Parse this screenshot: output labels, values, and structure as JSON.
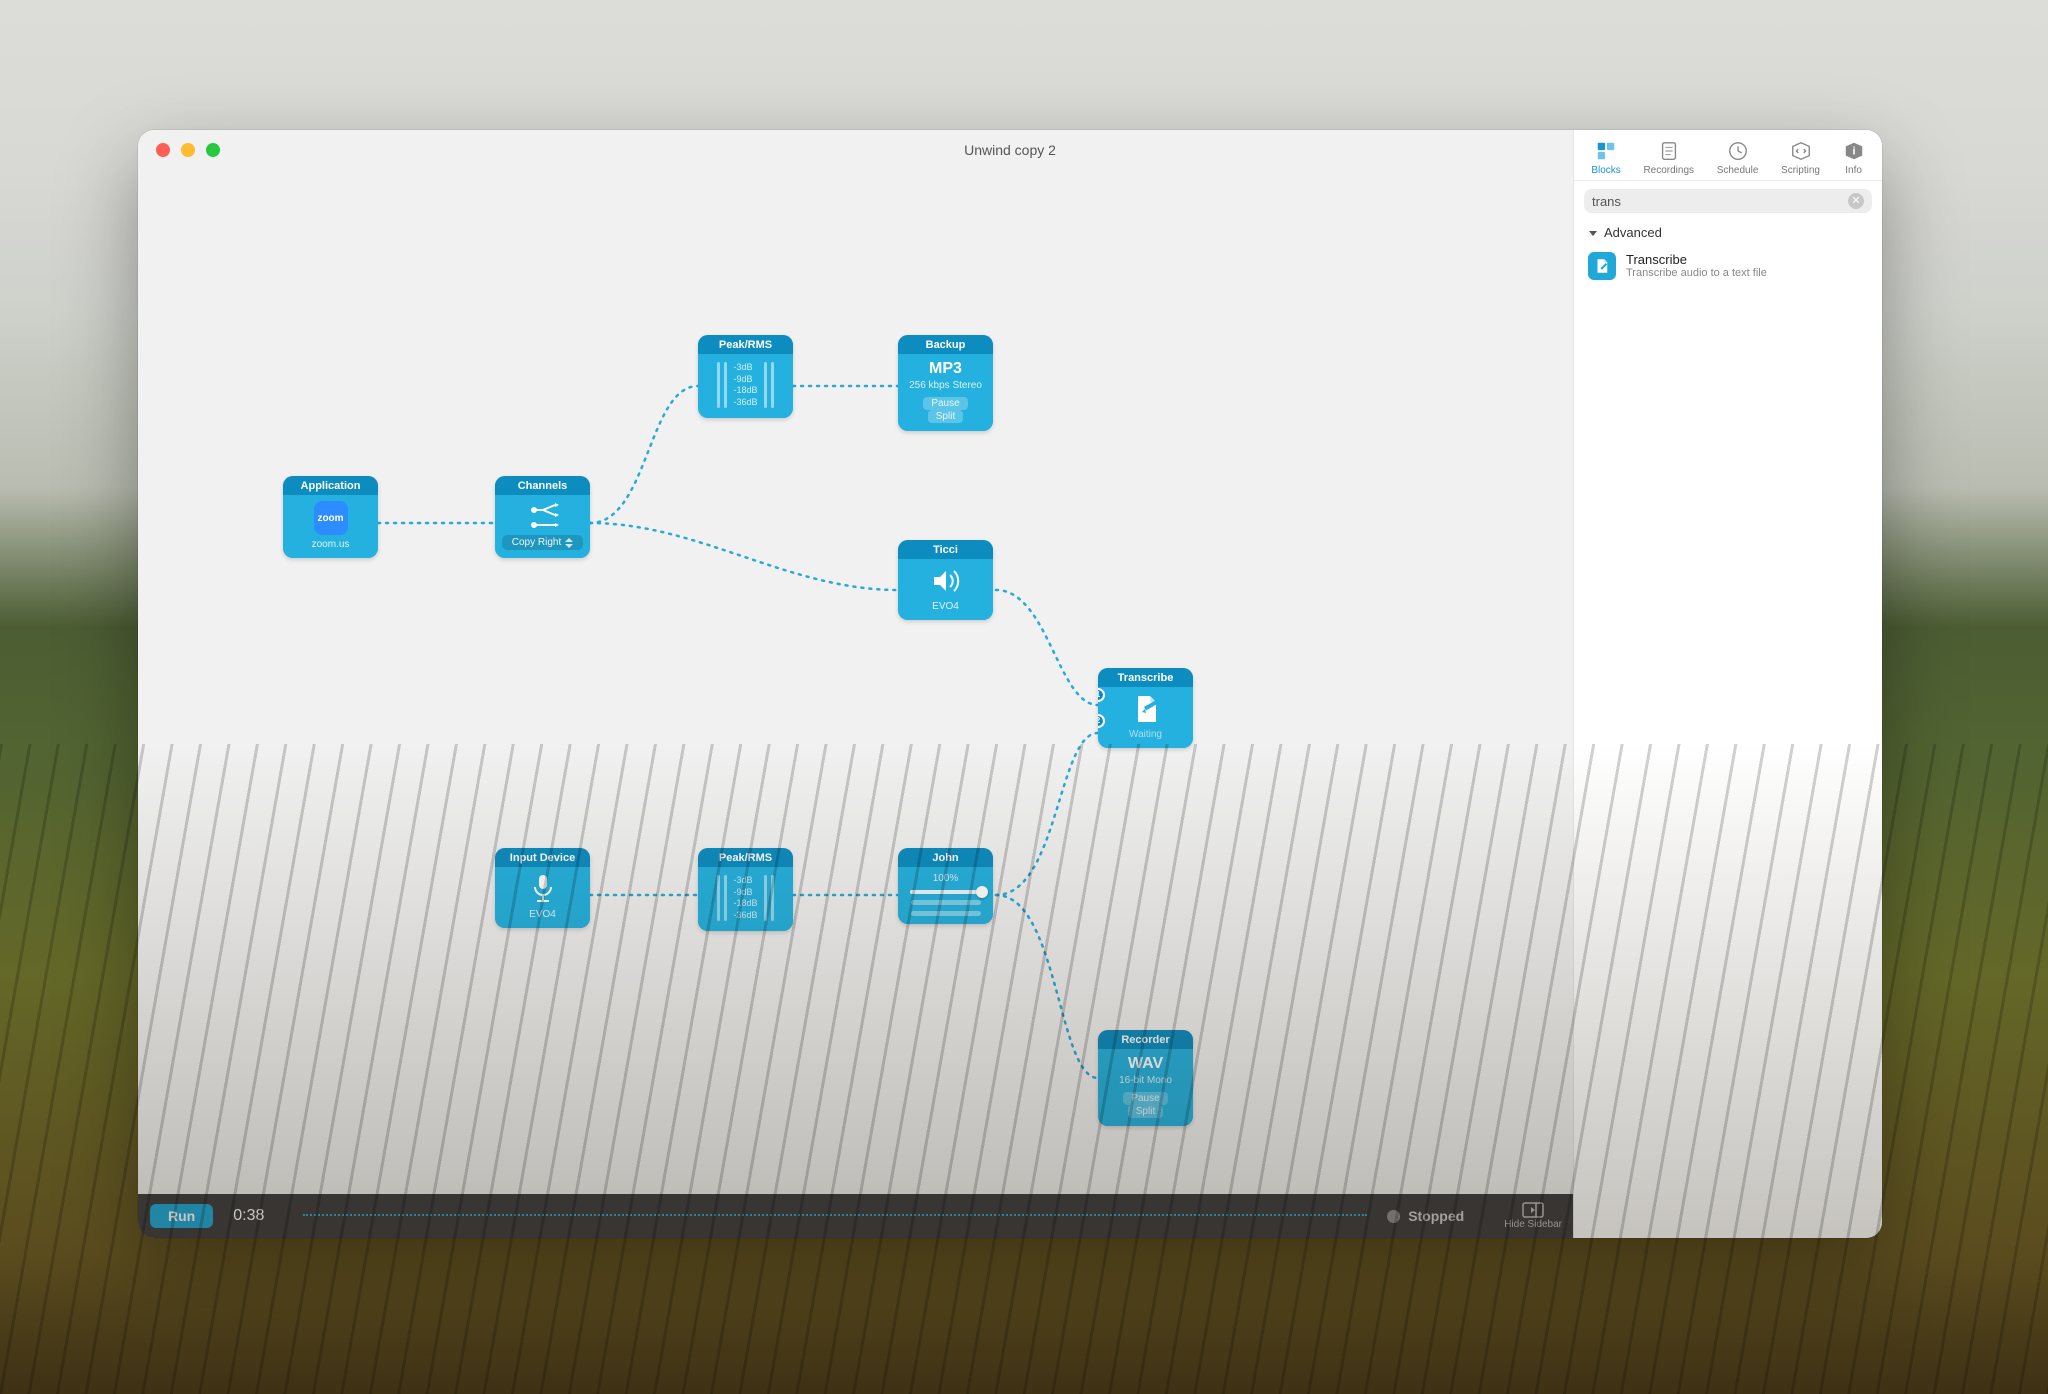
{
  "window": {
    "title": "Unwind copy 2"
  },
  "sidebar_tabs": {
    "blocks": "Blocks",
    "recordings": "Recordings",
    "schedule": "Schedule",
    "scripting": "Scripting",
    "info": "Info"
  },
  "search": {
    "value": "trans"
  },
  "category": "Advanced",
  "block_item": {
    "title": "Transcribe",
    "desc": "Transcribe audio to a text file"
  },
  "nodes": {
    "application": {
      "title": "Application",
      "footer": "zoom.us"
    },
    "channels": {
      "title": "Channels",
      "option": "Copy Right"
    },
    "peakrms1": {
      "title": "Peak/RMS",
      "l1": "-3dB",
      "l2": "-9dB",
      "l3": "-18dB",
      "l4": "-36dB"
    },
    "backup": {
      "title": "Backup",
      "format_big": "MP3",
      "rate": "256 kbps Stereo",
      "btn_pause": "Pause",
      "btn_split": "Split"
    },
    "ticci": {
      "title": "Ticci",
      "footer": "EVO4"
    },
    "transcribe": {
      "title": "Transcribe",
      "status": "Waiting"
    },
    "inputdev": {
      "title": "Input Device",
      "footer": "EVO4"
    },
    "peakrms2": {
      "title": "Peak/RMS",
      "l1": "-3dB",
      "l2": "-9dB",
      "l3": "-18dB",
      "l4": "-36dB"
    },
    "john": {
      "title": "John",
      "volume": "100%"
    },
    "recorder": {
      "title": "Recorder",
      "format_big": "WAV",
      "rate": "16-bit Mono",
      "btn_pause": "Pause",
      "btn_split": "Split"
    }
  },
  "transport": {
    "run": "Run",
    "time": "0:38",
    "status": "Stopped",
    "hide_sidebar": "Hide Sidebar"
  }
}
